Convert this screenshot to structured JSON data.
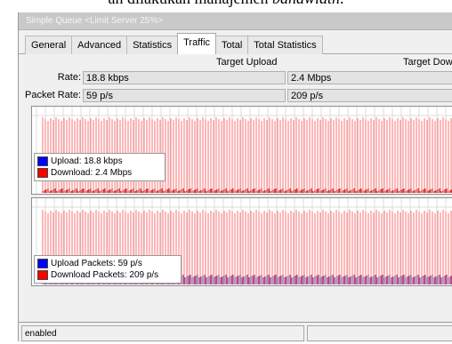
{
  "background_text": {
    "before": "an dilakukan manajemen ",
    "italic": "bandwidth",
    "after": "."
  },
  "window": {
    "title": "Simple Queue <Limit Server 25%>",
    "tabs": [
      "General",
      "Advanced",
      "Statistics",
      "Traffic",
      "Total",
      "Total Statistics"
    ],
    "active_tab": "Traffic"
  },
  "traffic": {
    "col_upload": "Target Upload",
    "col_download": "Target Dow",
    "rate_label": "Rate:",
    "rate_upload": "18.8 kbps",
    "rate_download": "2.4 Mbps",
    "packet_rate_label": "Packet Rate:",
    "packet_upload": "59 p/s",
    "packet_download": "209 p/s"
  },
  "graph_rate": {
    "legend_upload": "Upload:  18.8 kbps",
    "legend_download": "Download:  2.4 Mbps"
  },
  "graph_packets": {
    "legend_upload": "Upload Packets:  59 p/s",
    "legend_download": "Download Packets:  209 p/s"
  },
  "colors": {
    "upload": "#0000ff",
    "download": "#ff0000",
    "grid": "#dcdcdc",
    "traffic_line": "#ff7070",
    "packet_overlap": "#7a2a8a"
  },
  "status": {
    "text": "enabled"
  }
}
